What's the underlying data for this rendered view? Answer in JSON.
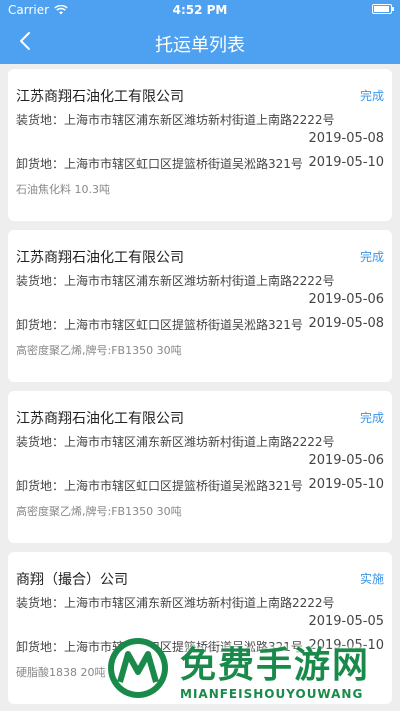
{
  "status_bar": {
    "carrier": "Carrier",
    "time": "4:52 PM"
  },
  "nav": {
    "title": "托运单列表"
  },
  "orders": [
    {
      "company": "江苏商翔石油化工有限公司",
      "status": "完成",
      "load_address": "装货地：上海市市辖区浦东新区潍坊新村街道上南路2222号",
      "load_date": "2019-05-08",
      "unload_address": "卸货地：上海市市辖区虹口区提篮桥街道吴淞路321号",
      "unload_date": "2019-05-10",
      "goods": "石油焦化料  10.3吨"
    },
    {
      "company": "江苏商翔石油化工有限公司",
      "status": "完成",
      "load_address": "装货地：上海市市辖区浦东新区潍坊新村街道上南路2222号",
      "load_date": "2019-05-06",
      "unload_address": "卸货地：上海市市辖区虹口区提篮桥街道吴淞路321号",
      "unload_date": "2019-05-08",
      "goods": "高密度聚乙烯,牌号:FB1350  30吨"
    },
    {
      "company": "江苏商翔石油化工有限公司",
      "status": "完成",
      "load_address": "装货地：上海市市辖区浦东新区潍坊新村街道上南路2222号",
      "load_date": "2019-05-06",
      "unload_address": "卸货地：上海市市辖区虹口区提篮桥街道吴淞路321号",
      "unload_date": "2019-05-10",
      "goods": "高密度聚乙烯,牌号:FB1350  30吨"
    },
    {
      "company": "商翔（撮合）公司",
      "status": "实施",
      "load_address": "装货地：上海市市辖区浦东新区潍坊新村街道上南路2222号",
      "load_date": "2019-05-05",
      "unload_address": "卸货地：上海市市辖区虹口区提篮桥街道吴淞路321号",
      "unload_date": "2019-05-10",
      "goods": "硬脂酸1838  20吨"
    }
  ],
  "watermark": {
    "title": "免费手游网",
    "subtitle": "MIANFEISHOUYOUWANG"
  }
}
